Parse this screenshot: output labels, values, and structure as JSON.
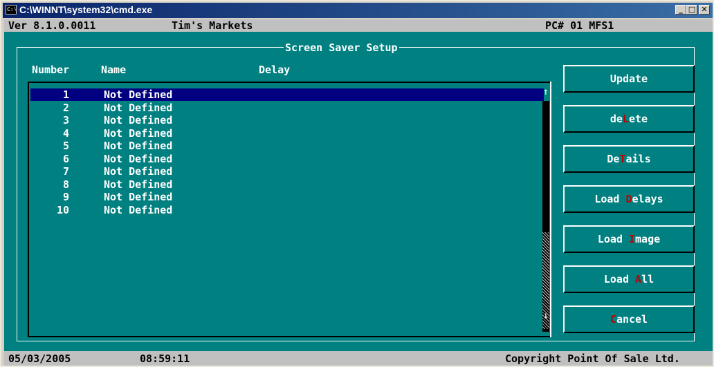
{
  "window": {
    "title": "C:\\WINNT\\system32\\cmd.exe",
    "icon_label": "C:\\"
  },
  "header": {
    "version": "Ver 8.1.0.0011",
    "store": "Tim's Markets",
    "station": "PC# 01 MFS1"
  },
  "panel": {
    "title": "Screen Saver Setup",
    "columns": [
      "Number",
      "Name",
      "Delay"
    ]
  },
  "list": {
    "selected_index": 0,
    "rows": [
      {
        "number": "1",
        "name": "Not Defined"
      },
      {
        "number": "2",
        "name": "Not Defined"
      },
      {
        "number": "3",
        "name": "Not Defined"
      },
      {
        "number": "4",
        "name": "Not Defined"
      },
      {
        "number": "5",
        "name": "Not Defined"
      },
      {
        "number": "6",
        "name": "Not Defined"
      },
      {
        "number": "7",
        "name": "Not Defined"
      },
      {
        "number": "8",
        "name": "Not Defined"
      },
      {
        "number": "9",
        "name": "Not Defined"
      },
      {
        "number": "10",
        "name": "Not Defined"
      }
    ]
  },
  "buttons": [
    {
      "id": "update",
      "pre": "",
      "hot": "",
      "post": "Update"
    },
    {
      "id": "delete",
      "pre": "de",
      "hot": "L",
      "post": "ete"
    },
    {
      "id": "details",
      "pre": "De",
      "hot": "T",
      "post": "ails"
    },
    {
      "id": "load-delays",
      "pre": "Load ",
      "hot": "D",
      "post": "elays"
    },
    {
      "id": "load-image",
      "pre": "Load ",
      "hot": "I",
      "post": "mage"
    },
    {
      "id": "load-all",
      "pre": "Load ",
      "hot": "A",
      "post": "ll"
    },
    {
      "id": "cancel",
      "pre": "",
      "hot": "C",
      "post": "ancel"
    }
  ],
  "footer": {
    "date": "05/03/2005",
    "time": "08:59:11",
    "copyright": "Copyright Point Of Sale Ltd."
  },
  "colors": {
    "console_bg": "#008080",
    "selection": "#000080",
    "hotkey": "#c00000",
    "status_bar": "#c0c0c0"
  }
}
